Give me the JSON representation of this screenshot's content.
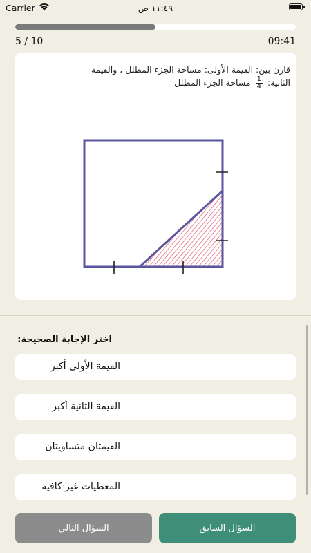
{
  "status_bar": {
    "carrier": "Carrier",
    "time": "١١:٤٩ ص"
  },
  "progress": {
    "fraction": 0.5,
    "count_label": "5 / 10",
    "timer": "09:41"
  },
  "question": {
    "line1": "قارن بين: القيمة الأولى: مساحة الجزء المظلل ، والقيمة",
    "line2_prefix": "الثانية:",
    "fraction_num": "1",
    "fraction_den": "4",
    "line2_suffix": "مساحة الجزء المظلل"
  },
  "figure": {
    "square_color": "#5b55a0",
    "hatch_color": "#e0586a",
    "shaded_region": "right-triangle-bottom-right"
  },
  "answers": {
    "prompt": "اختر الإجابة الصحيحة:",
    "options": [
      {
        "label": "القيمة الأولى أكبر"
      },
      {
        "label": "القيمة الثانية أكبر"
      },
      {
        "label": "القيمتان متساويتان"
      },
      {
        "label": "المعطيات غير كافية"
      }
    ]
  },
  "navigation": {
    "next_label": "السؤال التالي",
    "prev_label": "السؤال السابق"
  },
  "colors": {
    "background": "#f1efe4",
    "primary_button": "#3f8f78",
    "secondary_button": "#8c8c8c",
    "progress": "#7a7a7a"
  }
}
